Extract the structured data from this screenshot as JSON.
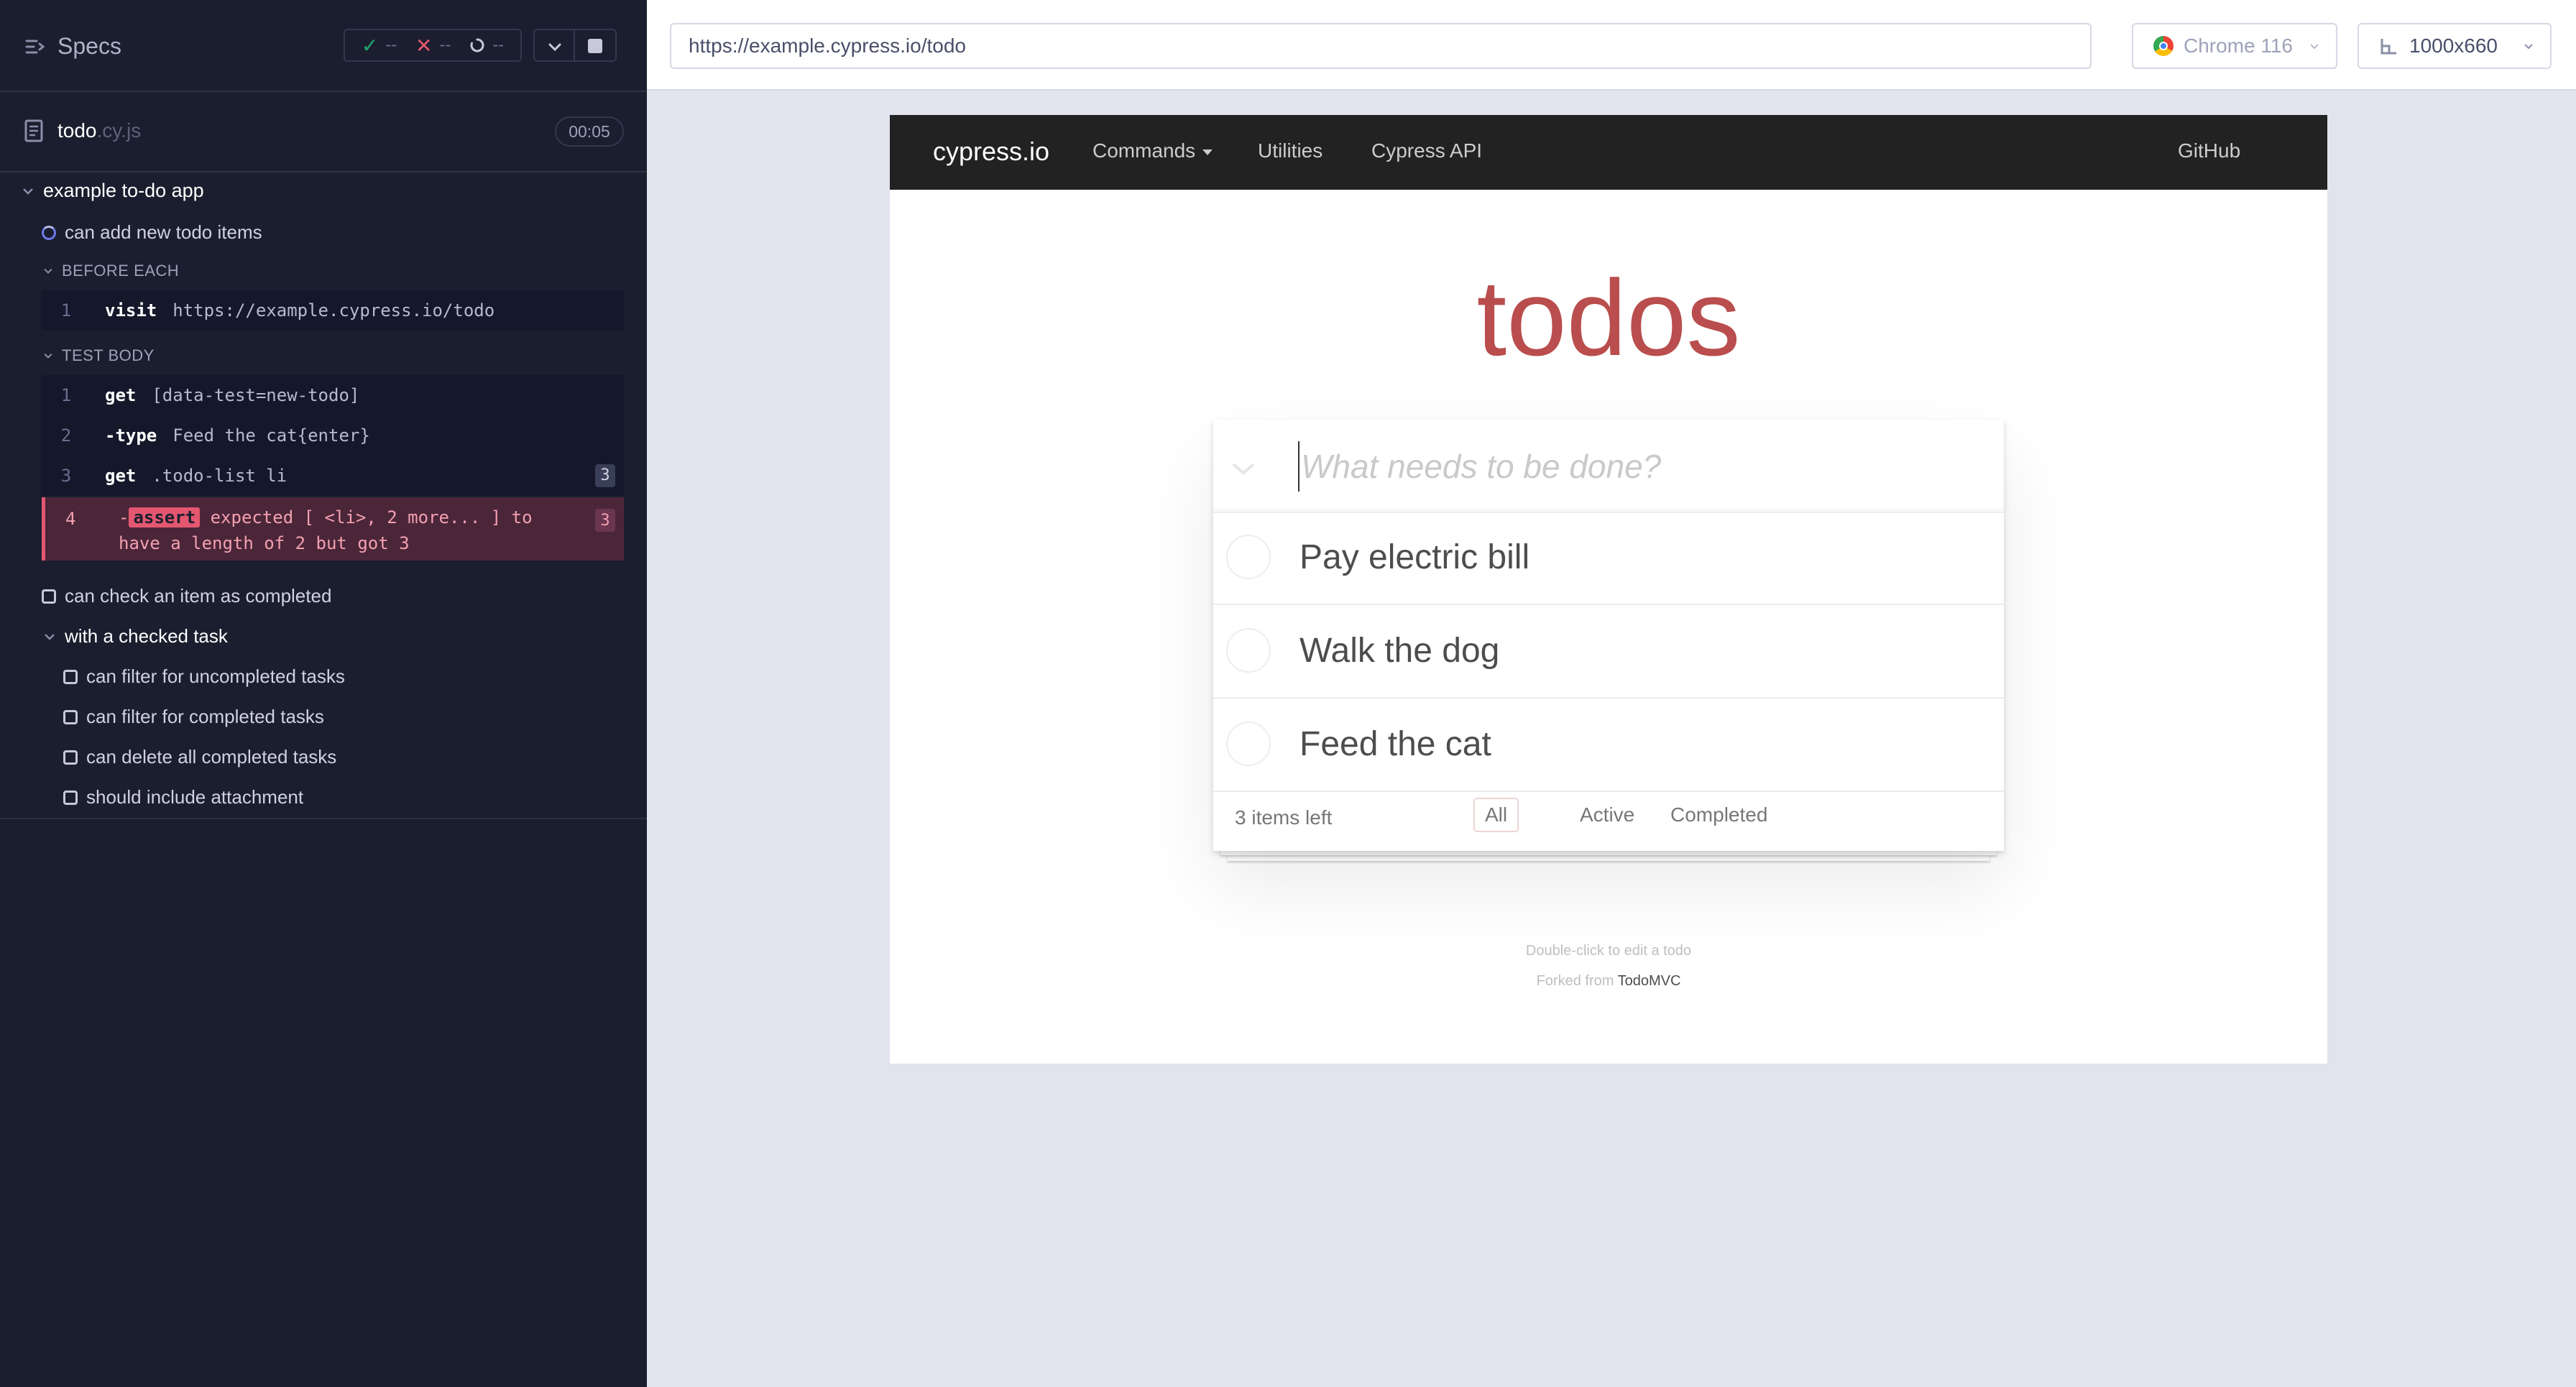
{
  "reporter": {
    "title": "Specs",
    "stats": {
      "passed": "--",
      "failed": "--",
      "pending": "--"
    },
    "file": {
      "name": "todo",
      "ext": ".cy.js",
      "duration": "00:05"
    },
    "suite": "example to-do app",
    "test_running": "can add new todo items",
    "before_each": {
      "label": "BEFORE EACH",
      "commands": [
        {
          "num": "1",
          "name": "visit",
          "message": "https://example.cypress.io/todo"
        }
      ]
    },
    "test_body": {
      "label": "TEST BODY",
      "commands": [
        {
          "num": "1",
          "name": "get",
          "message": "[data-test=new-todo]",
          "badge": ""
        },
        {
          "num": "2",
          "name": "-type",
          "message": "Feed the cat{enter}",
          "badge": ""
        },
        {
          "num": "3",
          "name": "get",
          "message": ".todo-list li",
          "badge": "3"
        }
      ],
      "failed": {
        "num": "4",
        "prefix": "-",
        "name": "assert",
        "line1": " expected [ <li>, 2 more... ] to",
        "line2": "have a length of 2 but got 3",
        "badge": "3"
      }
    },
    "tests": [
      "can check an item as completed"
    ],
    "nested_suite": "with a checked task",
    "nested_tests": [
      "can filter for uncompleted tasks",
      "can filter for completed tasks",
      "can delete all completed tasks",
      "should include attachment"
    ]
  },
  "topbar": {
    "url": "https://example.cypress.io/todo",
    "browser": "Chrome 116",
    "viewport": "1000x660"
  },
  "app": {
    "brand": "cypress.io",
    "nav": {
      "commands": "Commands",
      "utilities": "Utilities",
      "api": "Cypress API",
      "github": "GitHub"
    },
    "title": "todos",
    "new_todo_placeholder": "What needs to be done?",
    "todos": [
      "Pay electric bill",
      "Walk the dog",
      "Feed the cat"
    ],
    "items_left": "3 items left",
    "filters": {
      "all": "All",
      "active": "Active",
      "completed": "Completed"
    },
    "info_line1": "Double-click to edit a todo",
    "info_forked_prefix": "Forked from ",
    "info_forked_link": "TodoMVC"
  },
  "colors": {
    "reporter_bg": "#1b1e2e",
    "fail": "#e45770",
    "pass": "#1fa971",
    "todo_title": "#af2f2f",
    "navbar": "#222222"
  }
}
